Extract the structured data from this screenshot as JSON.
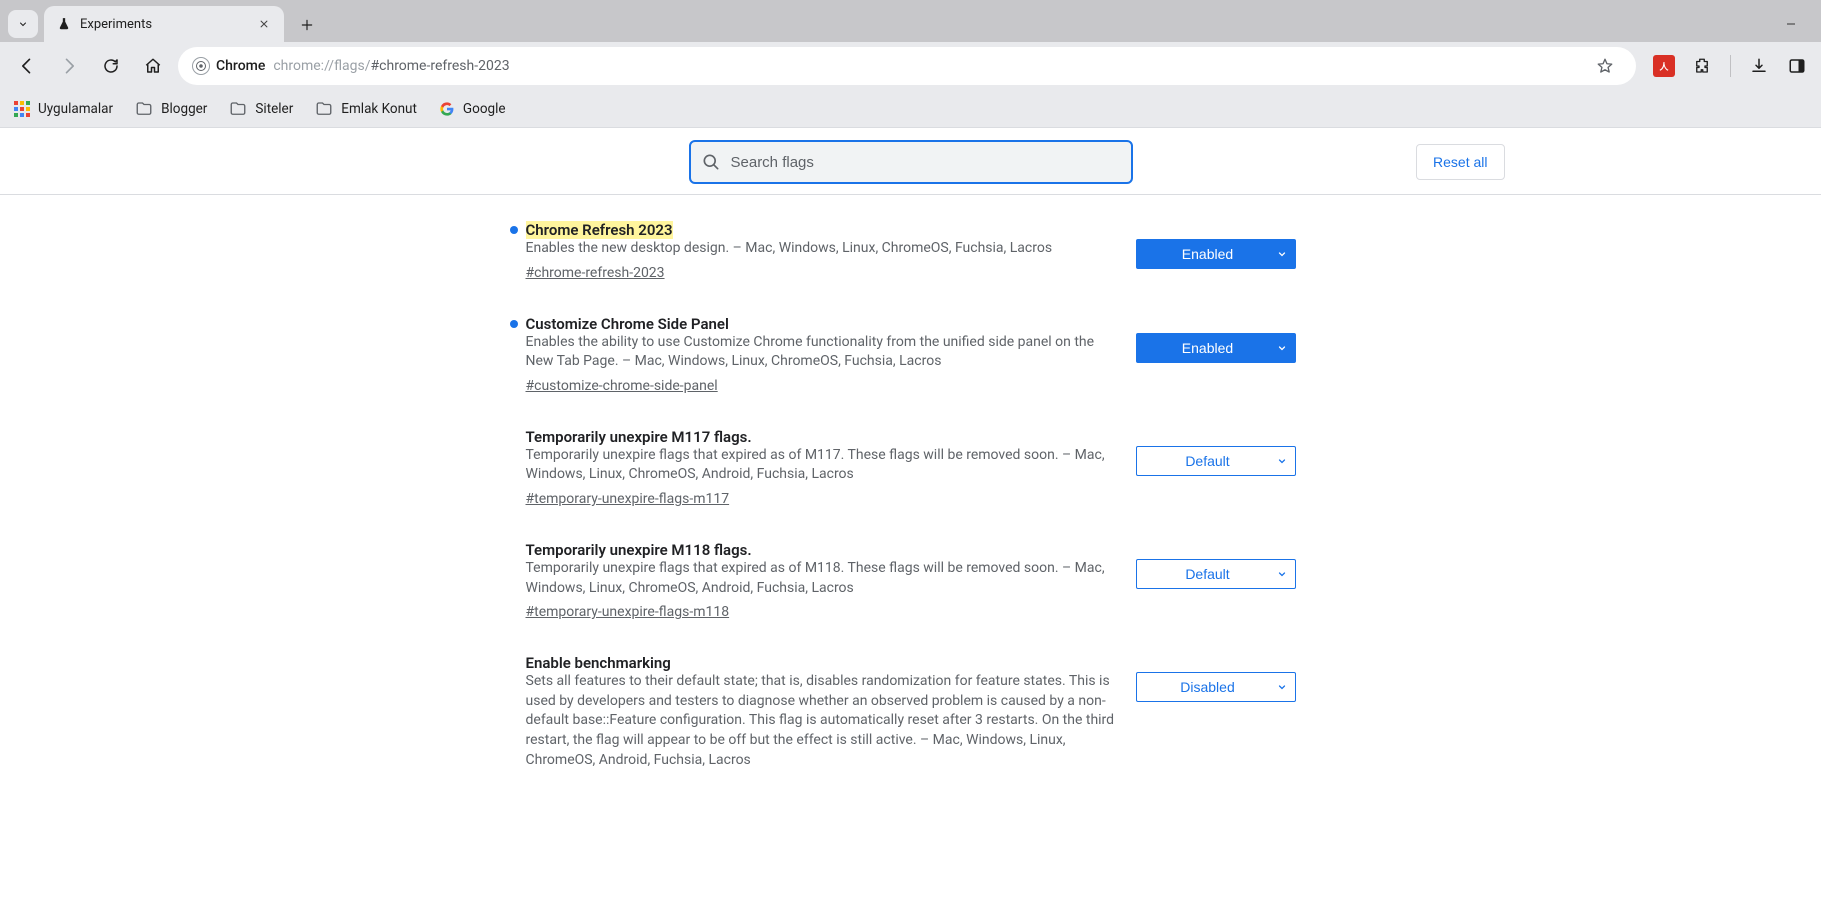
{
  "window": {
    "tab_title": "Experiments"
  },
  "toolbar": {
    "chip_label": "Chrome",
    "url_main": "chrome://flags/",
    "url_hash": "#chrome-refresh-2023"
  },
  "bookmarks": {
    "apps": "Uygulamalar",
    "items": [
      {
        "label": "Blogger"
      },
      {
        "label": "Siteler"
      },
      {
        "label": "Emlak Konut"
      },
      {
        "label": "Google"
      }
    ]
  },
  "search": {
    "placeholder": "Search flags"
  },
  "reset_label": "Reset all",
  "flags": [
    {
      "title": "Chrome Refresh 2023",
      "highlight": true,
      "modified": true,
      "desc": "Enables the new desktop design. – Mac, Windows, Linux, ChromeOS, Fuchsia, Lacros",
      "anchor": "#chrome-refresh-2023",
      "value": "Enabled",
      "filled": true
    },
    {
      "title": "Customize Chrome Side Panel",
      "highlight": false,
      "modified": true,
      "desc": "Enables the ability to use Customize Chrome functionality from the unified side panel on the New Tab Page. – Mac, Windows, Linux, ChromeOS, Fuchsia, Lacros",
      "anchor": "#customize-chrome-side-panel",
      "value": "Enabled",
      "filled": true
    },
    {
      "title": "Temporarily unexpire M117 flags.",
      "highlight": false,
      "modified": false,
      "desc": "Temporarily unexpire flags that expired as of M117. These flags will be removed soon. – Mac, Windows, Linux, ChromeOS, Android, Fuchsia, Lacros",
      "anchor": "#temporary-unexpire-flags-m117",
      "value": "Default",
      "filled": false
    },
    {
      "title": "Temporarily unexpire M118 flags.",
      "highlight": false,
      "modified": false,
      "desc": "Temporarily unexpire flags that expired as of M118. These flags will be removed soon. – Mac, Windows, Linux, ChromeOS, Android, Fuchsia, Lacros",
      "anchor": "#temporary-unexpire-flags-m118",
      "value": "Default",
      "filled": false
    },
    {
      "title": "Enable benchmarking",
      "highlight": false,
      "modified": false,
      "desc": "Sets all features to their default state; that is, disables randomization for feature states. This is used by developers and testers to diagnose whether an observed problem is caused by a non-default base::Feature configuration. This flag is automatically reset after 3 restarts. On the third restart, the flag will appear to be off but the effect is still active. – Mac, Windows, Linux, ChromeOS, Android, Fuchsia, Lacros",
      "anchor": "",
      "value": "Disabled",
      "filled": false
    }
  ]
}
